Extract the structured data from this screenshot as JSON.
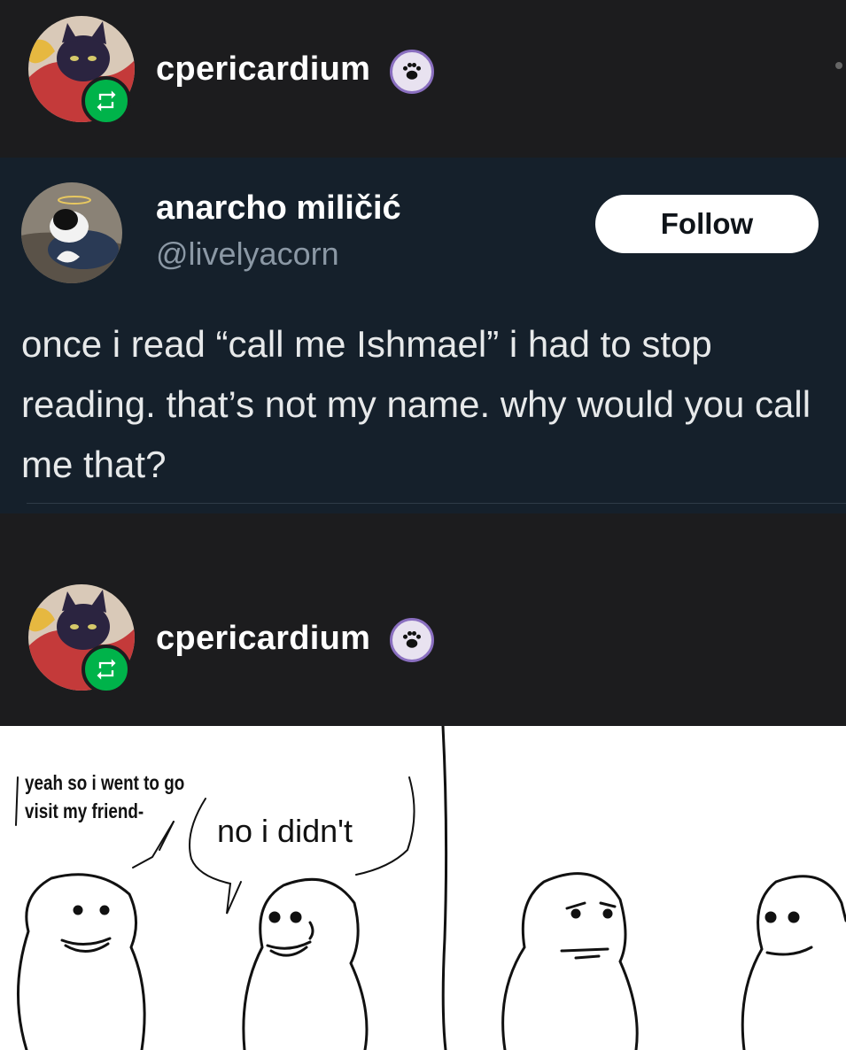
{
  "reblog_header_1": {
    "username": "cpericardium"
  },
  "tweet": {
    "display_name": "anarcho miličić",
    "handle": "@livelyacorn",
    "follow_label": "Follow",
    "text": "once i read “call me Ishmael” i had to stop reading. that’s not my name. why would you call me that?"
  },
  "reblog_header_2": {
    "username": "cpericardium"
  },
  "comic": {
    "bubble_1": "yeah so i went to go visit my friend-",
    "bubble_2": "no i didn't"
  },
  "colors": {
    "background": "#1c1c1e",
    "tweet_bg": "#15202b",
    "reblog_green": "#00b34a",
    "handle_gray": "#8b98a5"
  },
  "icons": [
    "avatar-image",
    "reblog-icon",
    "paw-badge-icon",
    "more-dot-icon"
  ]
}
